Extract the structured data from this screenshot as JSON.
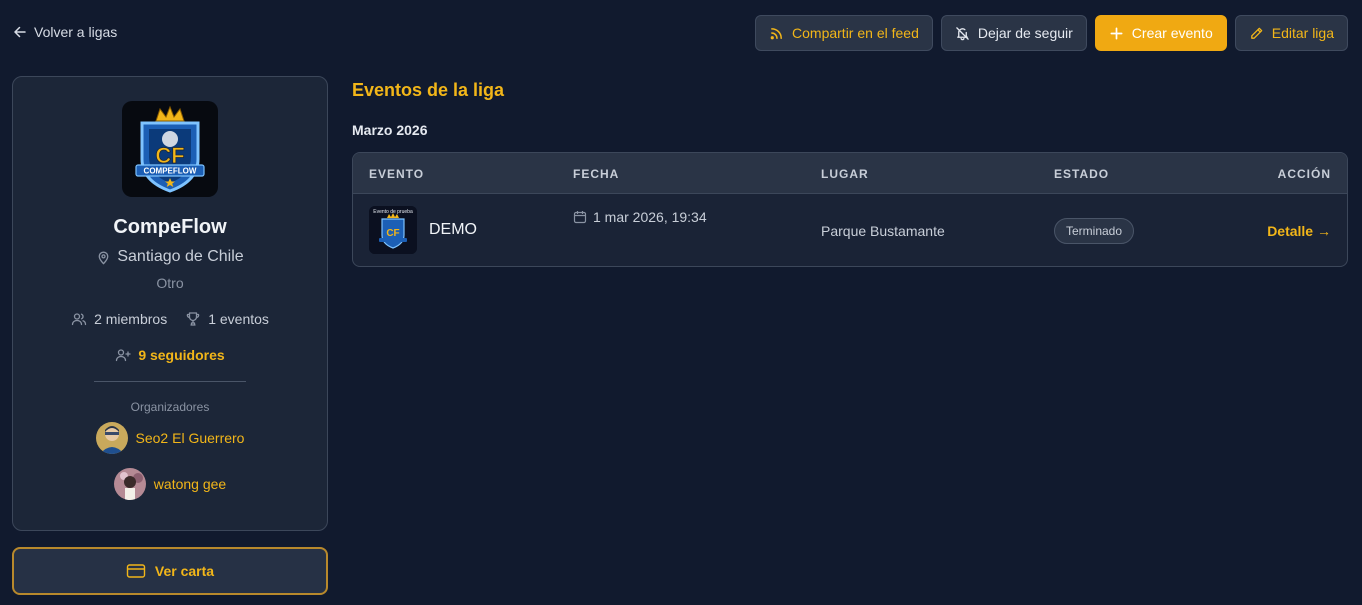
{
  "header": {
    "back_label": "Volver a ligas",
    "share_label": "Compartir en el feed",
    "unfollow_label": "Dejar de seguir",
    "create_label": "Crear evento",
    "edit_label": "Editar liga"
  },
  "league": {
    "logo_text": "CF",
    "logo_subtext": "COMPEFLOW",
    "name": "CompeFlow",
    "location": "Santiago de Chile",
    "category": "Otro",
    "members": "2 miembros",
    "events": "1 eventos",
    "followers": "9 seguidores",
    "organizers_title": "Organizadores",
    "organizers": [
      {
        "name": "Seo2 El Guerrero"
      },
      {
        "name": "watong gee"
      }
    ],
    "card_button_label": "Ver carta"
  },
  "events_section": {
    "title": "Eventos de la liga",
    "month": "Marzo 2026",
    "columns": [
      "EVENTO",
      "FECHA",
      "LUGAR",
      "ESTADO",
      "ACCIÓN"
    ],
    "rows": [
      {
        "thumb_title": "Evento de prueba",
        "thumb_logo": "CF",
        "name": "DEMO",
        "date": "1 mar 2026, 19:34",
        "place": "Parque Bustamante",
        "status": "Terminado",
        "action": "Detalle →"
      }
    ]
  },
  "colors": {
    "background": "#111a2e",
    "accent": "#f2b619",
    "primary_button": "#f0a912",
    "card": "#1c2638"
  }
}
